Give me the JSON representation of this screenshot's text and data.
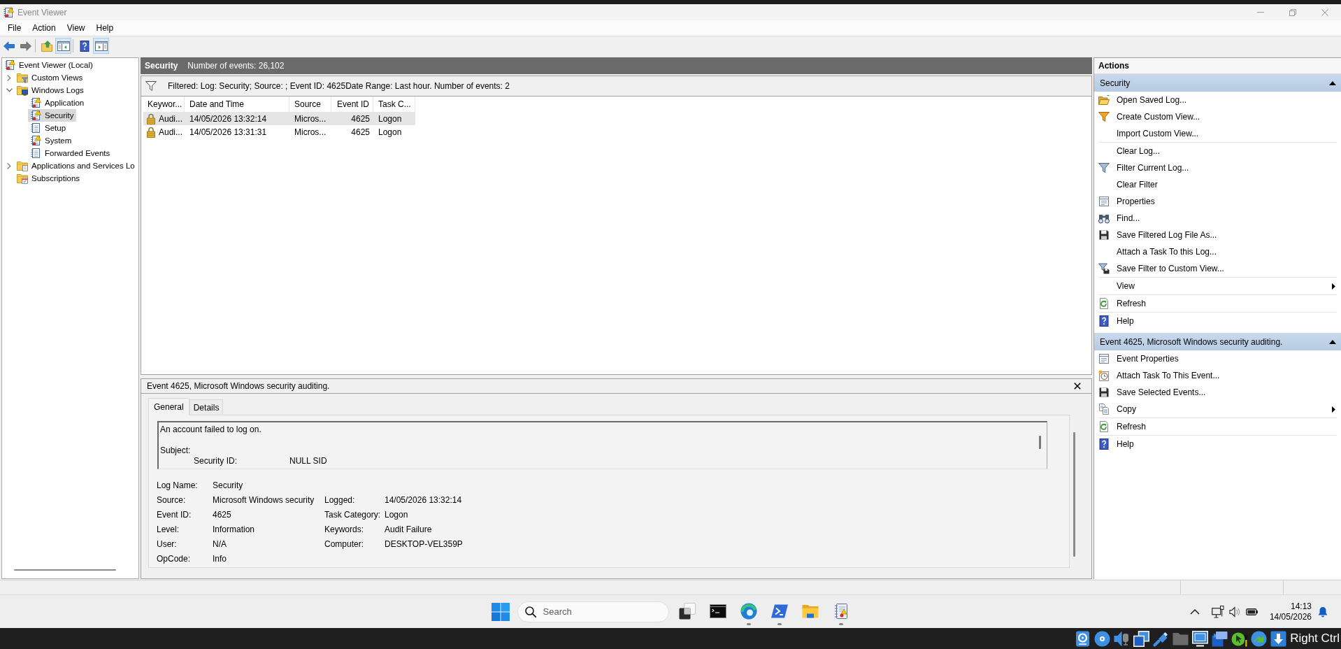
{
  "window": {
    "title": "Event Viewer"
  },
  "menu": [
    "File",
    "Action",
    "View",
    "Help"
  ],
  "toolbar": {
    "groups": [
      {
        "buttons": [
          {
            "kind": "back",
            "on": false,
            "disabled": false
          },
          {
            "kind": "forward",
            "on": false,
            "disabled": true
          }
        ]
      },
      {
        "buttons": [
          {
            "kind": "up",
            "on": false,
            "disabled": false
          },
          {
            "kind": "tree-toggle",
            "on": true,
            "disabled": false
          }
        ]
      },
      {
        "buttons": [
          {
            "kind": "help",
            "on": false,
            "disabled": false
          },
          {
            "kind": "pane-toggle",
            "on": true,
            "disabled": false
          }
        ]
      }
    ]
  },
  "tree": [
    {
      "label": "Event Viewer (Local)",
      "kind": "root",
      "selected": false,
      "children": [
        {
          "label": "Custom Views",
          "kind": "folder-filter",
          "expanded": false,
          "selected": false
        },
        {
          "label": "Windows Logs",
          "kind": "folder-logs",
          "expanded": true,
          "selected": false,
          "children": [
            {
              "label": "Application",
              "kind": "log-warning",
              "selected": false
            },
            {
              "label": "Security",
              "kind": "log-warning",
              "selected": true
            },
            {
              "label": "Setup",
              "kind": "log",
              "selected": false
            },
            {
              "label": "System",
              "kind": "log-warning",
              "selected": false
            },
            {
              "label": "Forwarded Events",
              "kind": "log",
              "selected": false
            }
          ]
        },
        {
          "label": "Applications and Services Lo",
          "kind": "folder-apps",
          "expanded": false,
          "selected": false
        },
        {
          "label": "Subscriptions",
          "kind": "folder-subscriptions",
          "selected": false
        }
      ]
    }
  ],
  "log_header": {
    "title": "Security",
    "count": "Number of events: 26,102"
  },
  "filter": {
    "summary": "Filtered: Log: Security; Source: ; Event ID: 4625Date Range: Last hour. Number of events: 2"
  },
  "table": {
    "columns": [
      "Keywor...",
      "Date and Time",
      "Source",
      "Event ID",
      "Task C..."
    ],
    "rows": [
      {
        "selected": true,
        "cells": [
          "Audi...",
          "14/05/2026 13:32:14",
          "Micros...",
          "4625",
          "Logon"
        ]
      },
      {
        "selected": false,
        "cells": [
          "Audi...",
          "14/05/2026 13:31:31",
          "Micros...",
          "4625",
          "Logon"
        ]
      }
    ]
  },
  "event_detail": {
    "title": "Event 4625, Microsoft Windows security auditing.",
    "tabs": [
      {
        "label": "General",
        "selected": true
      },
      {
        "label": "Details",
        "selected": false
      }
    ],
    "description": {
      "summary": "An account failed to log on.",
      "section": "Subject:",
      "fields": [
        {
          "label": "Security ID:",
          "value": "NULL SID"
        }
      ]
    },
    "properties": [
      {
        "left": {
          "label": "Log Name:",
          "value": "Security"
        }
      },
      {
        "left": {
          "label": "Source:",
          "value": "Microsoft Windows security"
        },
        "right": {
          "label": "Logged:",
          "value": "14/05/2026 13:32:14"
        }
      },
      {
        "left": {
          "label": "Event ID:",
          "value": "4625"
        },
        "right": {
          "label": "Task Category:",
          "value": "Logon"
        }
      },
      {
        "left": {
          "label": "Level:",
          "value": "Information"
        },
        "right": {
          "label": "Keywords:",
          "value": "Audit Failure"
        }
      },
      {
        "left": {
          "label": "User:",
          "value": "N/A"
        },
        "right": {
          "label": "Computer:",
          "value": "DESKTOP-VEL359P"
        }
      },
      {
        "left": {
          "label": "OpCode:",
          "value": "Info"
        }
      }
    ]
  },
  "actions": {
    "title": "Actions",
    "groups": [
      {
        "title": "Security",
        "expanded": true,
        "items": [
          {
            "label": "Open Saved Log...",
            "kind": "open",
            "submenu": false,
            "divider_above": false
          },
          {
            "label": "Create Custom View...",
            "kind": "create-view",
            "submenu": false,
            "divider_above": false
          },
          {
            "label": "Import Custom View...",
            "kind": "plain",
            "submenu": false,
            "divider_above": false
          },
          {
            "label": "Clear Log...",
            "kind": "plain",
            "submenu": false,
            "divider_above": true
          },
          {
            "label": "Filter Current Log...",
            "kind": "filter",
            "submenu": false,
            "divider_above": false
          },
          {
            "label": "Clear Filter",
            "kind": "plain",
            "submenu": false,
            "divider_above": false
          },
          {
            "label": "Properties",
            "kind": "properties",
            "submenu": false,
            "divider_above": false
          },
          {
            "label": "Find...",
            "kind": "find",
            "submenu": false,
            "divider_above": false
          },
          {
            "label": "Save Filtered Log File As...",
            "kind": "save",
            "submenu": false,
            "divider_above": false
          },
          {
            "label": "Attach a Task To this Log...",
            "kind": "plain",
            "submenu": false,
            "divider_above": false
          },
          {
            "label": "Save Filter to Custom View...",
            "kind": "save-filter",
            "submenu": false,
            "divider_above": false
          },
          {
            "label": "View",
            "kind": "plain",
            "submenu": true,
            "divider_above": true
          },
          {
            "label": "Refresh",
            "kind": "refresh",
            "submenu": false,
            "divider_above": true
          },
          {
            "label": "Help",
            "kind": "help",
            "submenu": false,
            "divider_above": true
          }
        ]
      },
      {
        "title": "Event 4625, Microsoft Windows security auditing.",
        "expanded": true,
        "items": [
          {
            "label": "Event Properties",
            "kind": "properties",
            "submenu": false,
            "divider_above": false
          },
          {
            "label": "Attach Task To This Event...",
            "kind": "attach-task",
            "submenu": false,
            "divider_above": false
          },
          {
            "label": "Save Selected Events...",
            "kind": "save",
            "submenu": false,
            "divider_above": false
          },
          {
            "label": "Copy",
            "kind": "copy",
            "submenu": true,
            "divider_above": false
          },
          {
            "label": "Refresh",
            "kind": "refresh",
            "submenu": false,
            "divider_above": true
          },
          {
            "label": "Help",
            "kind": "help",
            "submenu": false,
            "divider_above": true
          }
        ]
      }
    ]
  },
  "taskbar": {
    "search": {
      "placeholder": "Search"
    },
    "apps": [
      {
        "kind": "task-view",
        "running": false
      },
      {
        "kind": "terminal",
        "running": false
      },
      {
        "kind": "browser",
        "running": true
      },
      {
        "kind": "shell",
        "running": true
      },
      {
        "kind": "files",
        "running": false
      },
      {
        "kind": "log-viewer",
        "running": true
      }
    ]
  },
  "tray": {
    "time": "14:13",
    "date": "14/05/2026"
  },
  "host_bar": {
    "indicators": [
      {
        "kind": "disk"
      },
      {
        "kind": "optical"
      },
      {
        "kind": "audio"
      },
      {
        "kind": "network"
      },
      {
        "kind": "usb"
      },
      {
        "kind": "shared-folder"
      },
      {
        "kind": "display"
      },
      {
        "kind": "capture"
      },
      {
        "kind": "mouse"
      },
      {
        "kind": "guest"
      },
      {
        "kind": "keyboard"
      }
    ],
    "host_key": "Right Ctrl"
  }
}
